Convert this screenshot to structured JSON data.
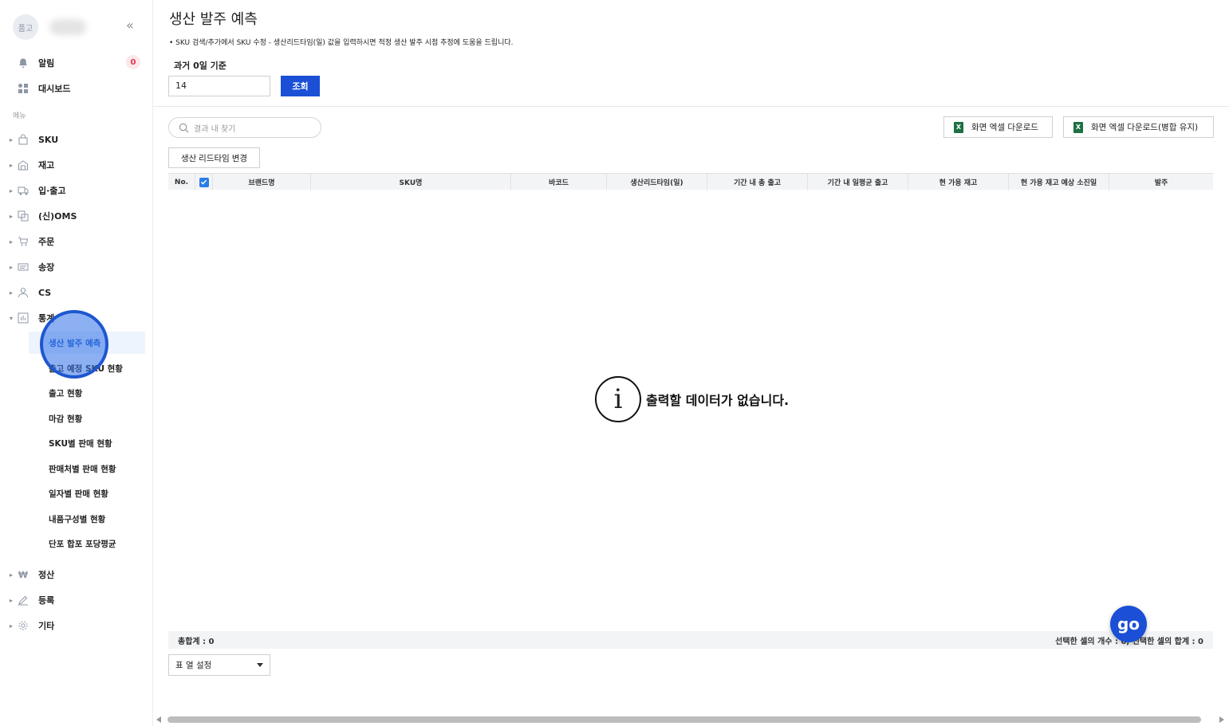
{
  "sidebar": {
    "avatar_text": "품고",
    "collapse_icon": "«",
    "top_items": [
      {
        "label": "알림",
        "icon": "bell-icon",
        "badge": "0"
      },
      {
        "label": "대시보드",
        "icon": "dashboard-icon"
      }
    ],
    "menu_label": "메뉴",
    "items": [
      {
        "label": "SKU",
        "icon": "bag-icon"
      },
      {
        "label": "재고",
        "icon": "warehouse-icon"
      },
      {
        "label": "입·출고",
        "icon": "truck-icon"
      },
      {
        "label": "(신)OMS",
        "icon": "oms-icon"
      },
      {
        "label": "주문",
        "icon": "cart-icon"
      },
      {
        "label": "송장",
        "icon": "invoice-icon"
      },
      {
        "label": "CS",
        "icon": "person-icon"
      },
      {
        "label": "통계",
        "icon": "chart-icon"
      }
    ],
    "stats_sub": [
      {
        "label": "생산 발주 예측",
        "active": true
      },
      {
        "label": "출고 예정 SKU 현황"
      },
      {
        "label": "출고 현황"
      },
      {
        "label": "마감 현황"
      },
      {
        "label": "SKU별 판매 현황"
      },
      {
        "label": "판매처별 판매 현황"
      },
      {
        "label": "일자별 판매 현황"
      },
      {
        "label": "내품구성별 현황"
      },
      {
        "label": "단포 합포 포당평균"
      }
    ],
    "bottom_items": [
      {
        "label": "정산",
        "icon": "won-icon"
      },
      {
        "label": "등록",
        "icon": "pencil-icon"
      },
      {
        "label": "기타",
        "icon": "gear-icon"
      }
    ]
  },
  "main": {
    "title": "생산 발주 예측",
    "notice": "• SKU 검색/추가에서 SKU 수정 - 생산리드타임(일) 값을 입력하시면 적정 생산 발주 시점 추정에 도움을 드립니다.",
    "period_label": "과거 0일 기준",
    "days_value": "14",
    "search_button": "조회",
    "result_search_placeholder": "결과 내 찾기",
    "excel_download": "화면 엑셀 다운로드",
    "excel_download_merged": "화면 엑셀 다운로드(병합 유지)",
    "leadtime_button": "생산 리드타임 변경",
    "columns": [
      "No.",
      "",
      "브랜드명",
      "SKU명",
      "바코드",
      "생산리드타임(일)",
      "기간 내 총 출고",
      "기간 내 일평균 출고",
      "현 가용 재고",
      "현 가용 재고 예상 소진일",
      "발주"
    ],
    "empty_message": "출력할 데이터가 없습니다.",
    "total_label": "총합계 : 0",
    "selection_summary": "선택한 셀의 개수 : 0, 선택한 셀의 합계 : 0",
    "column_settings": "표 열 설정",
    "fab_label": "go"
  }
}
